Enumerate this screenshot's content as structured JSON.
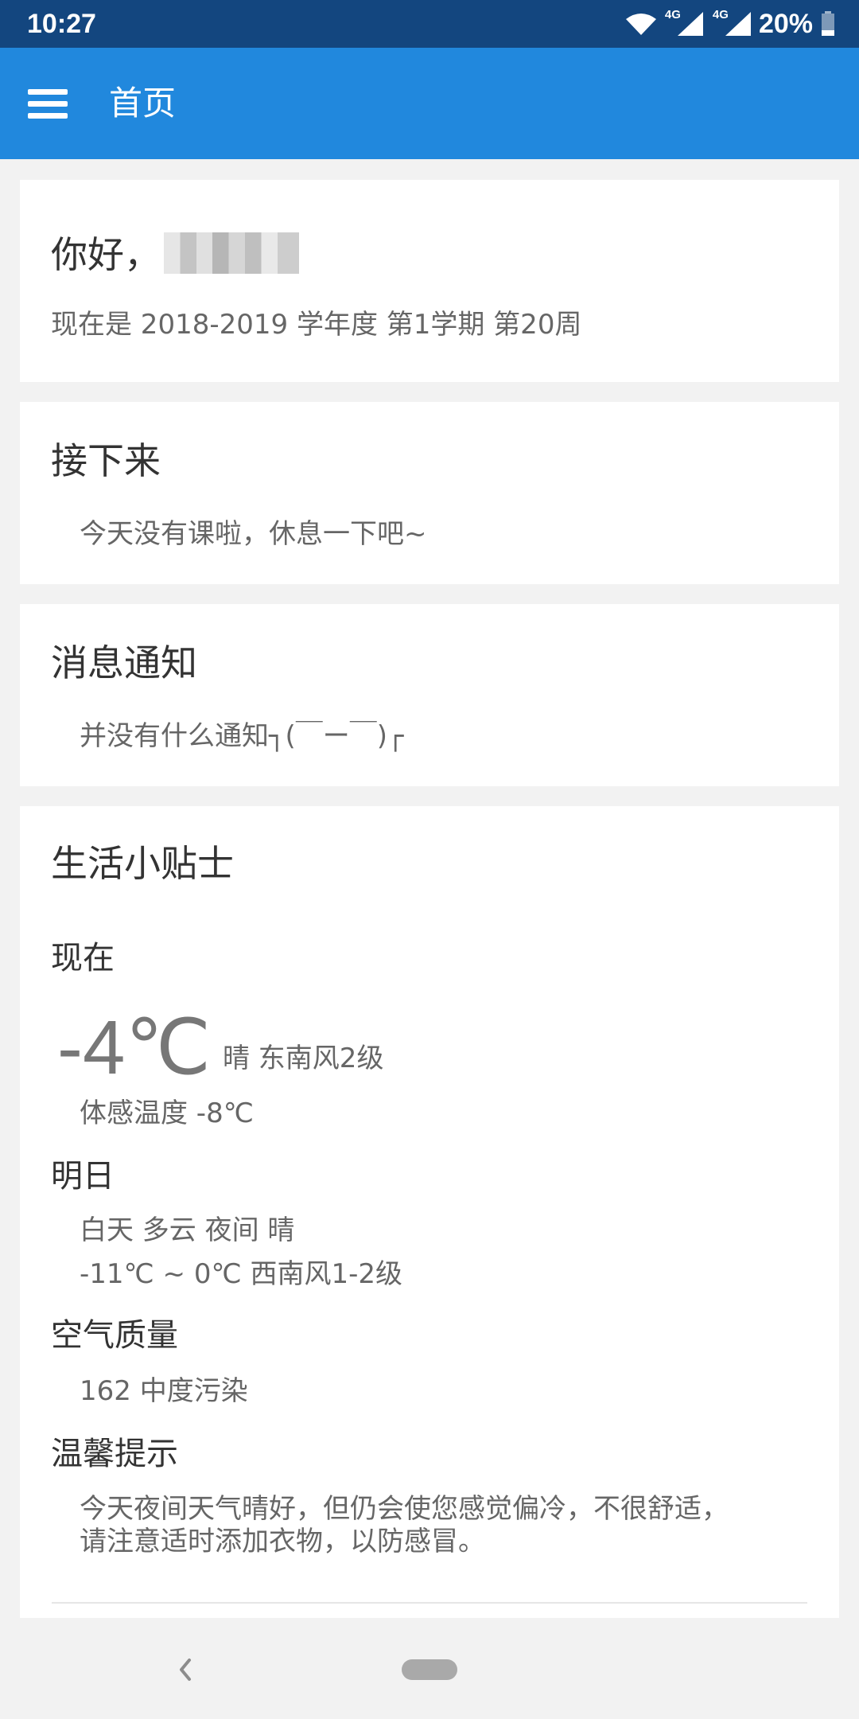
{
  "status_bar": {
    "time": "10:27",
    "network_1": "4G",
    "network_2": "4G",
    "battery": "20%",
    "icons": [
      "wifi-icon",
      "signal-icon",
      "signal-icon",
      "battery-icon"
    ]
  },
  "app_bar": {
    "title": "首页",
    "menu_icon": "menu-icon"
  },
  "greeting_card": {
    "greeting": "你好，",
    "term_info": "现在是 2018-2019 学年度 第1学期 第20周"
  },
  "next_card": {
    "title": "接下来",
    "message": "今天没有课啦，休息一下吧~"
  },
  "notice_card": {
    "title": "消息通知",
    "message": "并没有什么通知┐(￣ー￣)┌"
  },
  "tips_card": {
    "title": "生活小贴士",
    "now_label": "现在",
    "temperature": "-4℃",
    "weather_desc": "晴 东南风2级",
    "feels_like": "体感温度 -8℃",
    "tomorrow_label": "明日",
    "tomorrow_day_night": "白天 多云 夜间 晴",
    "tomorrow_temp_wind": "-11℃ ~ 0℃ 西南风1-2级",
    "air_quality_label": "空气质量",
    "air_quality_value": "162 中度污染",
    "reminder_label": "温馨提示",
    "reminder_line1": "今天夜间天气晴好，但仍会使您感觉偏冷，不很舒适，",
    "reminder_line2": "请注意适时添加衣物，以防感冒。"
  },
  "nav_bar": {
    "back_icon": "back-icon",
    "home_icon": "home-pill-icon"
  },
  "colors": {
    "status_bar": "#13467f",
    "app_bar": "#2188dd",
    "background": "#f2f2f2",
    "card": "#ffffff"
  }
}
